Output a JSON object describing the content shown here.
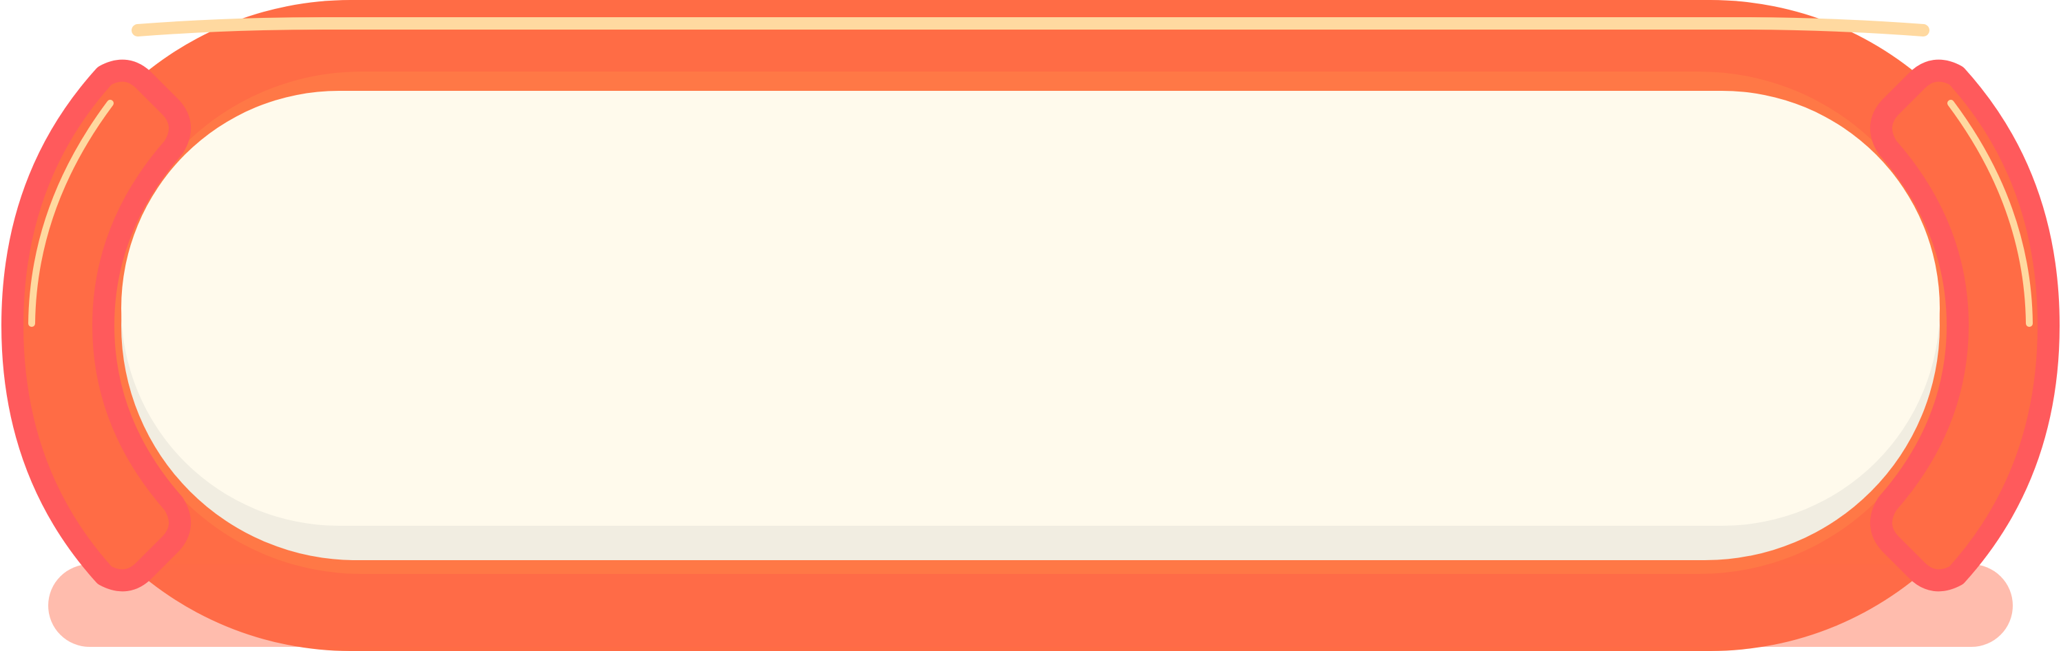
{
  "button": {
    "label": "",
    "style": "pill",
    "colors": {
      "outer": "#FF6C45",
      "outer_bottom": "#FF6A4A",
      "highlight": "#FFD9A0",
      "inner_fill": "#FFFAEC",
      "inner_shadow": "#F1EDE1",
      "cap_fill": "#FF6C45",
      "cap_stroke": "#FF5A5C"
    }
  }
}
